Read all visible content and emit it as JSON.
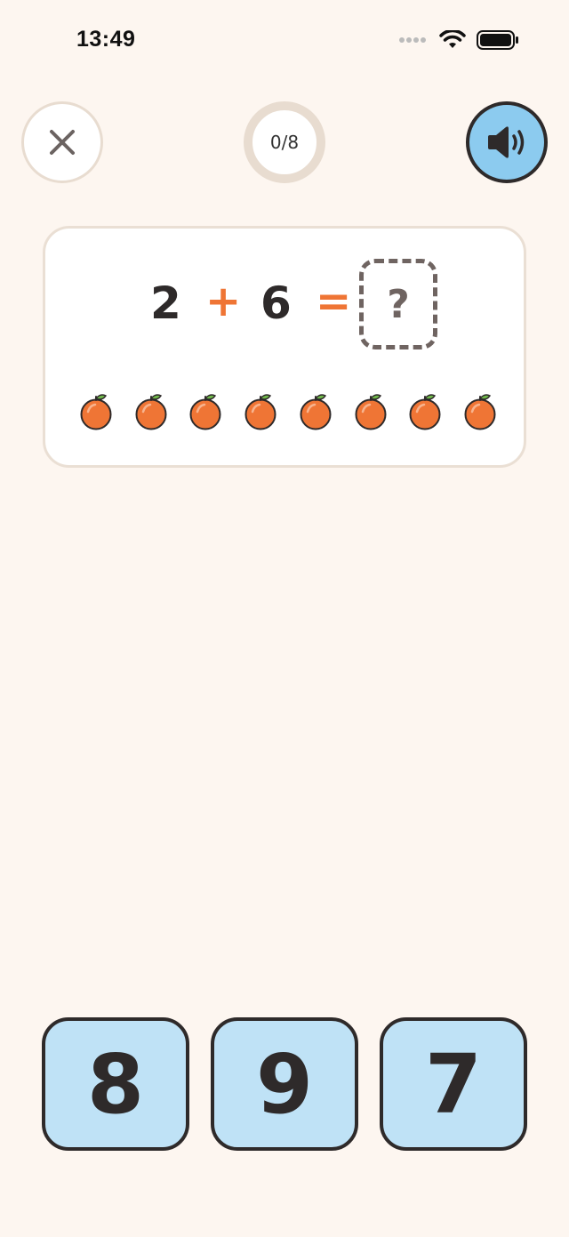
{
  "status_bar": {
    "time": "13:49",
    "icons": [
      "signal-dots-icon",
      "wifi-icon",
      "battery-icon"
    ]
  },
  "top_bar": {
    "close_icon": "close-icon",
    "progress": {
      "label": "0/8",
      "current": 0,
      "total": 8
    },
    "sound_icon": "speaker-icon",
    "sound_color": "#8ccbef"
  },
  "question": {
    "operand_a": "2",
    "operator": "+",
    "operand_b": "6",
    "equals": "=",
    "answer_placeholder": "?",
    "fruit_icon": "orange-icon",
    "fruit_count": 8,
    "operator_color": "#ef7535"
  },
  "choices": [
    "8",
    "9",
    "7"
  ],
  "colors": {
    "background": "#fdf6f0",
    "choice_fill": "#bfe2f6",
    "ink": "#2e2a2a"
  }
}
